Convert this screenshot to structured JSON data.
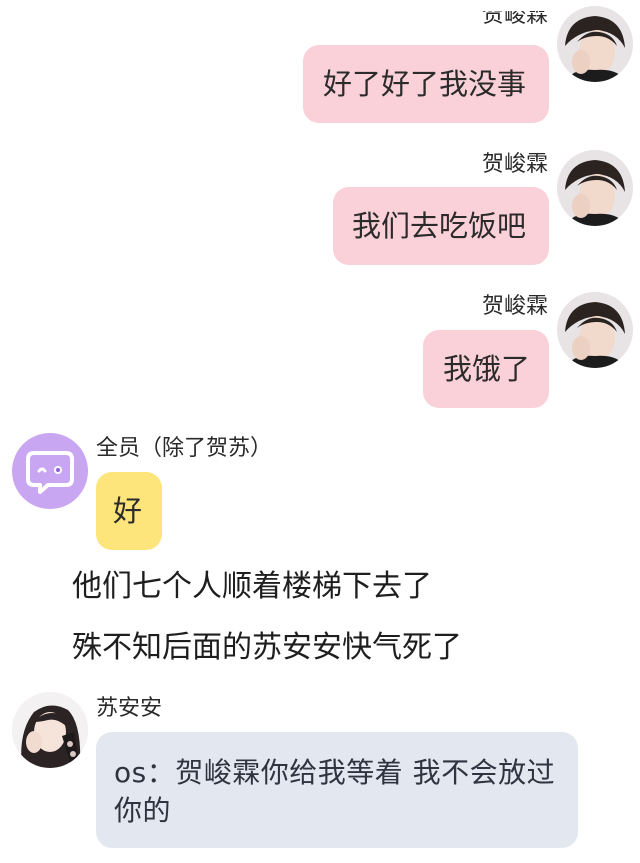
{
  "conversation": {
    "messages": [
      {
        "sender": "贺峻霖",
        "text": "好了好了我没事",
        "side": "right",
        "bubble_color": "#fbd1d9"
      },
      {
        "sender": "贺峻霖",
        "text": "我们去吃饭吧",
        "side": "right",
        "bubble_color": "#fbd1d9"
      },
      {
        "sender": "贺峻霖",
        "text": "我饿了",
        "side": "right",
        "bubble_color": "#fbd1d9"
      },
      {
        "sender": "全员（除了贺苏）",
        "text": "好",
        "side": "left",
        "bubble_color": "#fde57b"
      }
    ],
    "narration": [
      "他们七个人顺着楼梯下去了",
      "殊不知后面的苏安安快气死了"
    ],
    "last_message": {
      "sender": "苏安安",
      "text": "os：贺峻霖你给我等着 我不会放过你的",
      "side": "left",
      "bubble_color": "#e3e7ef"
    }
  },
  "avatars": {
    "hejunlin": "boy-portrait",
    "group": "chat-bubble-icon",
    "suanan": "girl-portrait"
  },
  "colors": {
    "group_avatar_bg": "#c9a6f2",
    "group_icon": "#ffffff",
    "pink_bubble": "#fbd1d9",
    "yellow_bubble": "#fde57b",
    "grey_bubble": "#e3e7ef"
  }
}
